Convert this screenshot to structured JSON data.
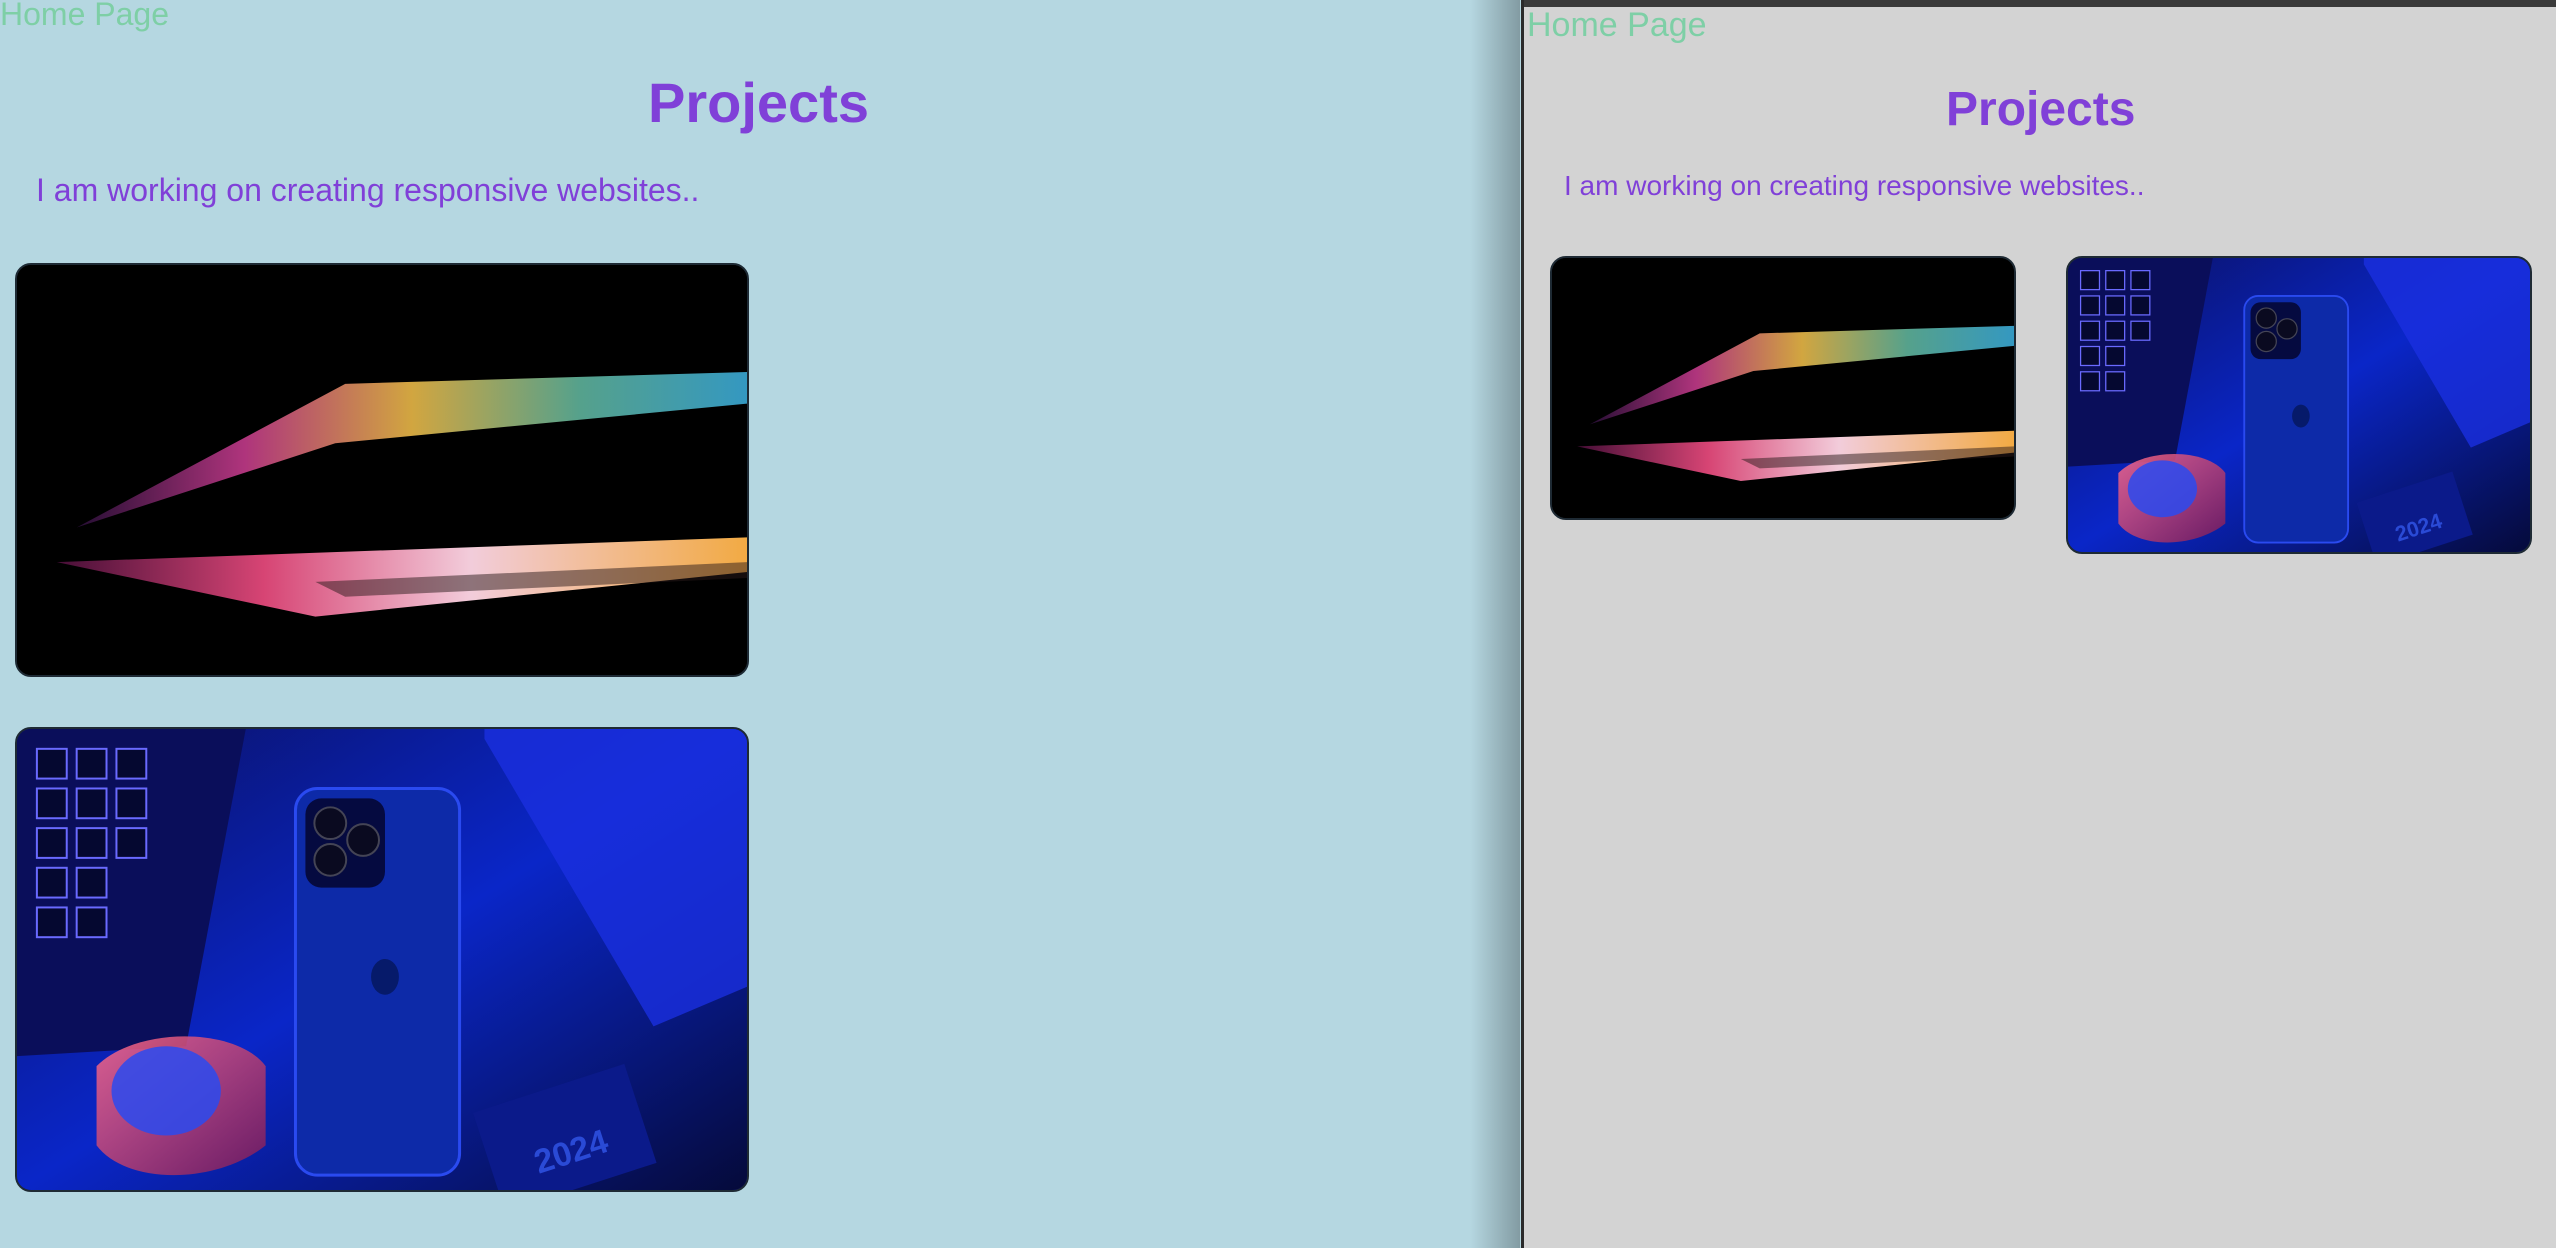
{
  "left_window": {
    "home_link": "Home Page",
    "heading": "Projects",
    "intro": "I am working on creating responsive websites..",
    "background_color": "#b5d7e1",
    "images": [
      {
        "name": "laptop-photo",
        "year_label": ""
      },
      {
        "name": "phone-photo",
        "year_label": "2024"
      }
    ]
  },
  "right_window": {
    "home_link": "Home Page",
    "heading": "Projects",
    "intro": "I am working on creating responsive websites..",
    "background_color": "#d3d3d3",
    "images": [
      {
        "name": "laptop-photo",
        "year_label": ""
      },
      {
        "name": "phone-photo",
        "year_label": "2024"
      }
    ]
  },
  "colors": {
    "link": "#7ecfa6",
    "heading": "#8040d8"
  }
}
